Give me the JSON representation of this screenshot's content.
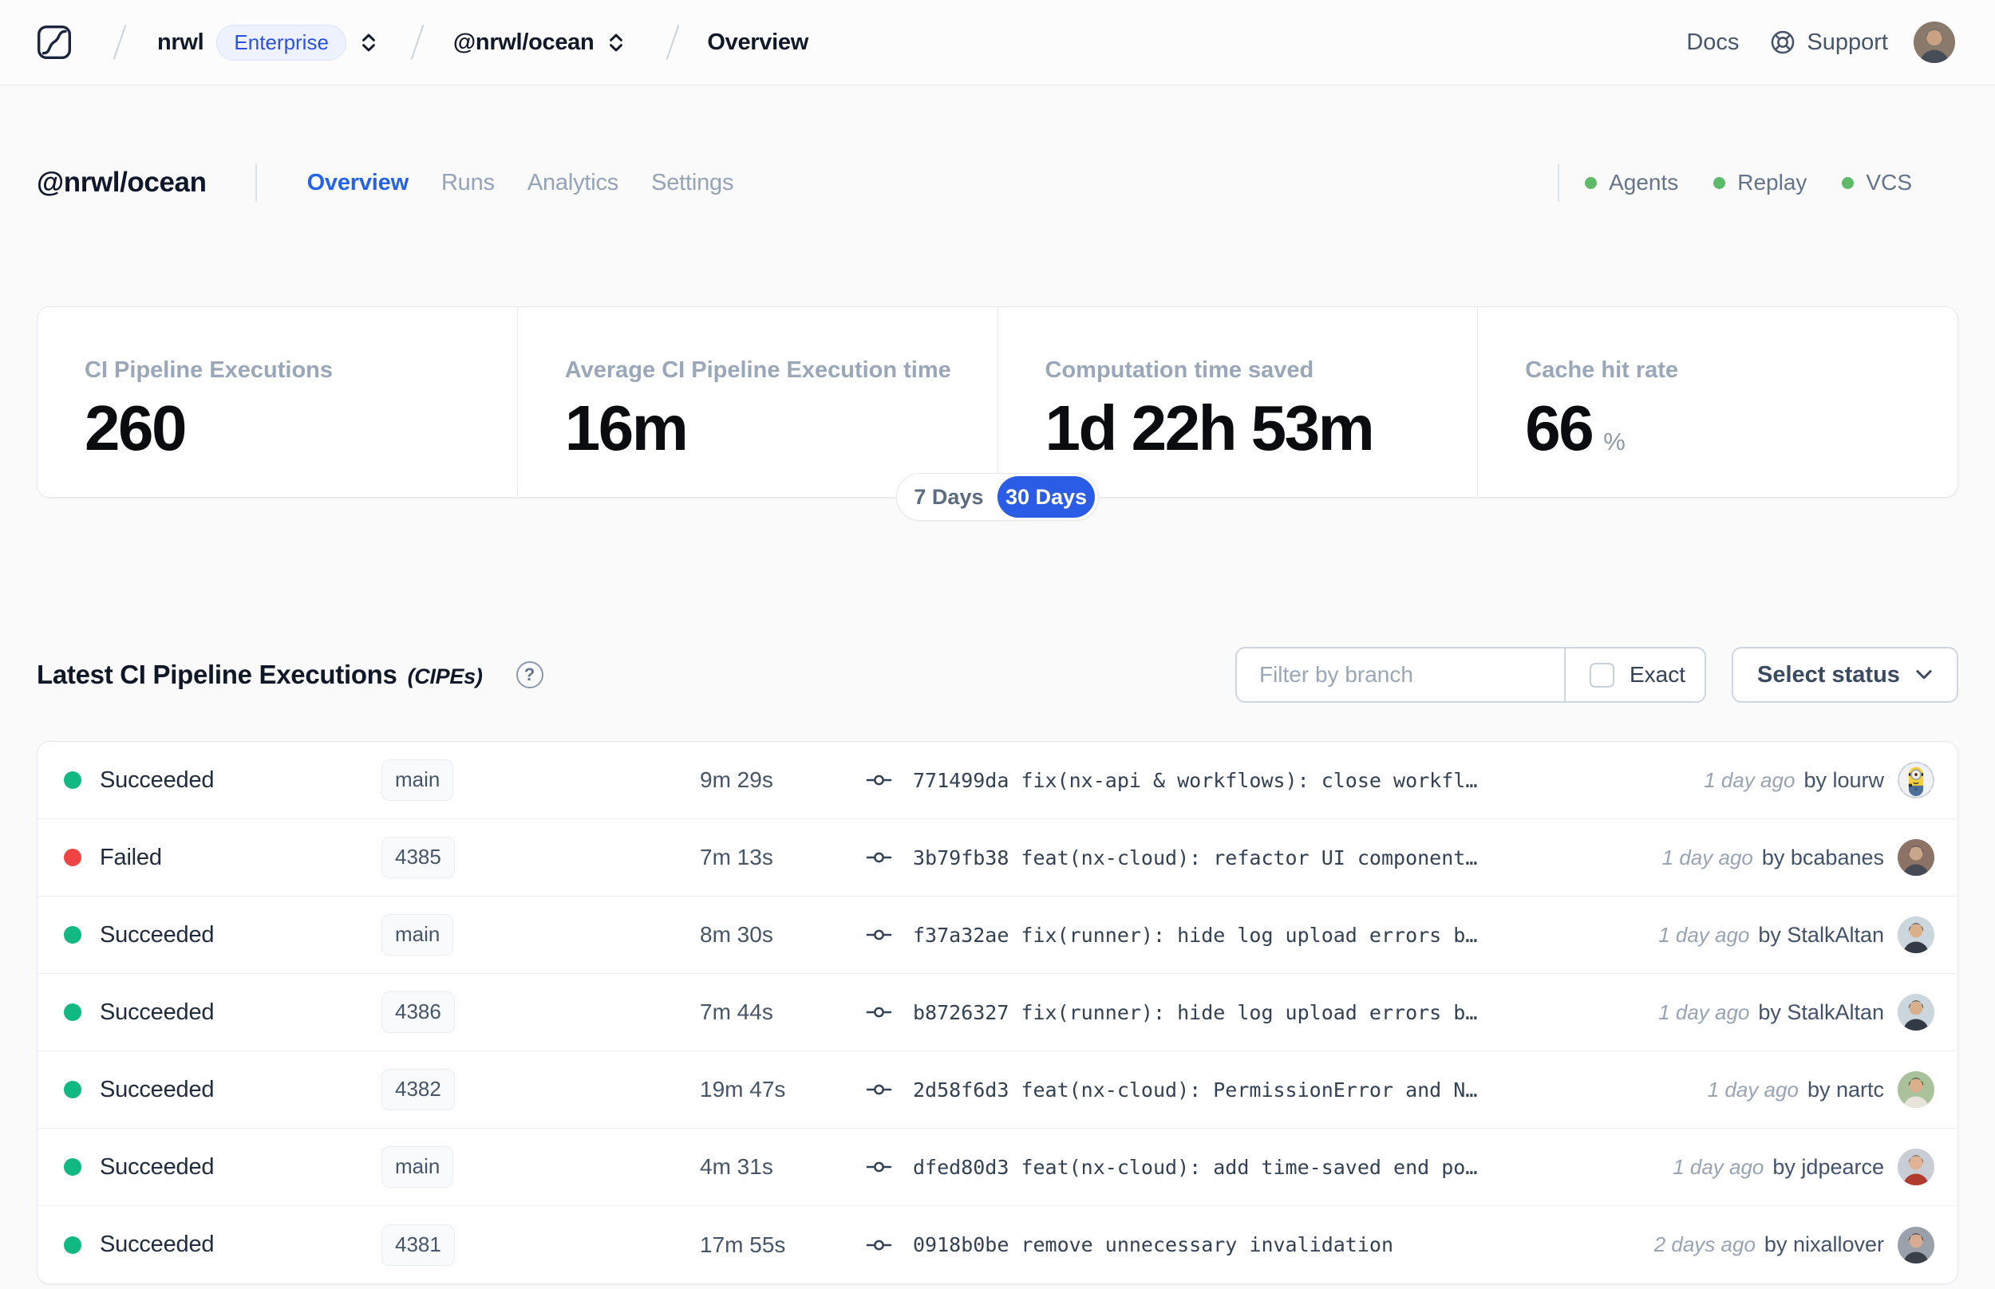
{
  "topbar": {
    "org": "nrwl",
    "org_badge": "Enterprise",
    "workspace": "@nrwl/ocean",
    "page": "Overview",
    "docs_label": "Docs",
    "support_label": "Support"
  },
  "workspace_header": {
    "title": "@nrwl/ocean",
    "tabs": [
      {
        "label": "Overview",
        "active": true
      },
      {
        "label": "Runs",
        "active": false
      },
      {
        "label": "Analytics",
        "active": false
      },
      {
        "label": "Settings",
        "active": false
      }
    ],
    "features": [
      {
        "label": "Agents",
        "status": "enabled"
      },
      {
        "label": "Replay",
        "status": "enabled"
      },
      {
        "label": "VCS",
        "status": "enabled"
      }
    ]
  },
  "stats": {
    "cards": [
      {
        "label": "CI Pipeline Executions",
        "value": "260"
      },
      {
        "label": "Average CI Pipeline Execution time",
        "value": "16m"
      },
      {
        "label": "Computation time saved",
        "value": "1d 22h 53m"
      },
      {
        "label": "Cache hit rate",
        "value": "66",
        "suffix": "%"
      }
    ],
    "range_toggle": {
      "options": [
        "7 Days",
        "30 Days"
      ],
      "selected": "30 Days"
    }
  },
  "executions": {
    "title": "Latest CI Pipeline Executions",
    "title_suffix": "(CIPEs)",
    "filter": {
      "placeholder": "Filter by branch",
      "exact_label": "Exact",
      "exact_checked": false
    },
    "status_select_label": "Select status",
    "rows": [
      {
        "status": "Succeeded",
        "branch": "main",
        "duration": "9m 29s",
        "commit": "771499da",
        "message": "fix(nx-api & workflows): close workfl…",
        "time_ago": "1 day ago",
        "author": "by lourw",
        "avatar": "minion"
      },
      {
        "status": "Failed",
        "branch": "4385",
        "duration": "7m 13s",
        "commit": "3b79fb38",
        "message": "feat(nx-cloud): refactor UI component…",
        "time_ago": "1 day ago",
        "author": "by bcabanes",
        "avatar": "person"
      },
      {
        "status": "Succeeded",
        "branch": "main",
        "duration": "8m 30s",
        "commit": "f37a32ae",
        "message": "fix(runner): hide log upload errors b…",
        "time_ago": "1 day ago",
        "author": "by StalkAltan",
        "avatar": "person"
      },
      {
        "status": "Succeeded",
        "branch": "4386",
        "duration": "7m 44s",
        "commit": "b8726327",
        "message": "fix(runner): hide log upload errors b…",
        "time_ago": "1 day ago",
        "author": "by StalkAltan",
        "avatar": "person"
      },
      {
        "status": "Succeeded",
        "branch": "4382",
        "duration": "19m 47s",
        "commit": "2d58f6d3",
        "message": "feat(nx-cloud): PermissionError and N…",
        "time_ago": "1 day ago",
        "author": "by nartc",
        "avatar": "person"
      },
      {
        "status": "Succeeded",
        "branch": "main",
        "duration": "4m 31s",
        "commit": "dfed80d3",
        "message": "feat(nx-cloud): add time-saved end po…",
        "time_ago": "1 day ago",
        "author": "by jdpearce",
        "avatar": "person"
      },
      {
        "status": "Succeeded",
        "branch": "4381",
        "duration": "17m 55s",
        "commit": "0918b0be",
        "message": "remove unnecessary invalidation",
        "time_ago": "2 days ago",
        "author": "by nixallover",
        "avatar": "person"
      }
    ]
  },
  "colors": {
    "accent_blue": "#2563eb",
    "toggle_blue": "#2b5ce6",
    "success_green": "#10b981",
    "failure_red": "#ef4444",
    "feature_green": "#5eb969"
  }
}
